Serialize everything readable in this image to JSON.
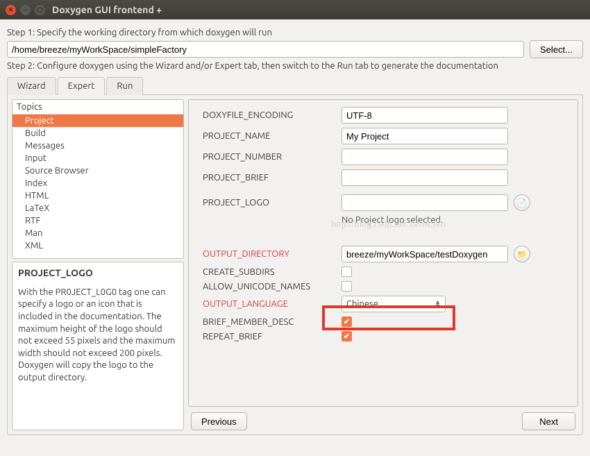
{
  "window": {
    "title": "Doxygen GUI frontend +"
  },
  "step1": {
    "label": "Step 1: Specify the working directory from which doxygen will run",
    "path": "/home/breeze/myWorkSpace/simpleFactory",
    "select_btn": "Select..."
  },
  "step2": {
    "label": "Step 2: Configure doxygen using the Wizard and/or Expert tab, then switch to the Run tab to generate the documentation"
  },
  "tabs": {
    "wizard": "Wizard",
    "expert": "Expert",
    "run": "Run"
  },
  "topics": {
    "header": "Topics",
    "items": [
      "Project",
      "Build",
      "Messages",
      "Input",
      "Source Browser",
      "Index",
      "HTML",
      "LaTeX",
      "RTF",
      "Man",
      "XML"
    ]
  },
  "desc": {
    "title": "PROJECT_LOGO",
    "body": "With the PR0JECT_L0G0 tag one can specify a logo or an icon that is included in the documentation. The maximum height of the logo should not exceed 55 pixels and the maximum width should not exceed 200 pixels. Doxygen will copy the logo to the output directory."
  },
  "form": {
    "doxyfile_encoding": {
      "label": "DOXYFILE_ENCODING",
      "value": "UTF-8"
    },
    "project_name": {
      "label": "PROJECT_NAME",
      "value": "My Project"
    },
    "project_number": {
      "label": "PROJECT_NUMBER",
      "value": ""
    },
    "project_brief": {
      "label": "PROJECT_BRIEF",
      "value": ""
    },
    "project_logo": {
      "label": "PROJECT_LOGO",
      "value": "",
      "status": "No Project logo selected."
    },
    "output_directory": {
      "label": "OUTPUT_DIRECTORY",
      "value": "breeze/myWorkSpace/testDoxygen"
    },
    "create_subdirs": {
      "label": "CREATE_SUBDIRS"
    },
    "allow_unicode_names": {
      "label": "ALLOW_UNICODE_NAMES"
    },
    "output_language": {
      "label": "OUTPUT_LANGUAGE",
      "value": "Chinese"
    },
    "brief_member_desc": {
      "label": "BRIEF_MEMBER_DESC"
    },
    "repeat_brief": {
      "label": "REPEAT_BRIEF"
    }
  },
  "watermark": "http://blog.csdn.net/ZeroLiko",
  "nav": {
    "prev": "Previous",
    "next": "Next"
  }
}
